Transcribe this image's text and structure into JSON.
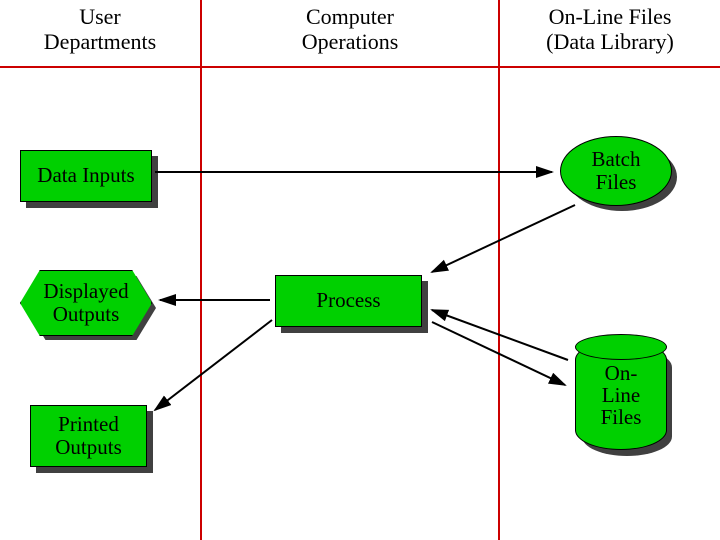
{
  "headers": {
    "col1_line1": "User",
    "col1_line2": "Departments",
    "col2_line1": "Computer",
    "col2_line2": "Operations",
    "col3_line1": "On-Line Files",
    "col3_line2": "(Data Library)"
  },
  "nodes": {
    "data_inputs": "Data Inputs",
    "displayed_outputs_l1": "Displayed",
    "displayed_outputs_l2": "Outputs",
    "printed_outputs_l1": "Printed",
    "printed_outputs_l2": "Outputs",
    "process": "Process",
    "batch_files_l1": "Batch",
    "batch_files_l2": "Files",
    "online_files_l1": "On-",
    "online_files_l2": "Line",
    "online_files_l3": "Files"
  }
}
